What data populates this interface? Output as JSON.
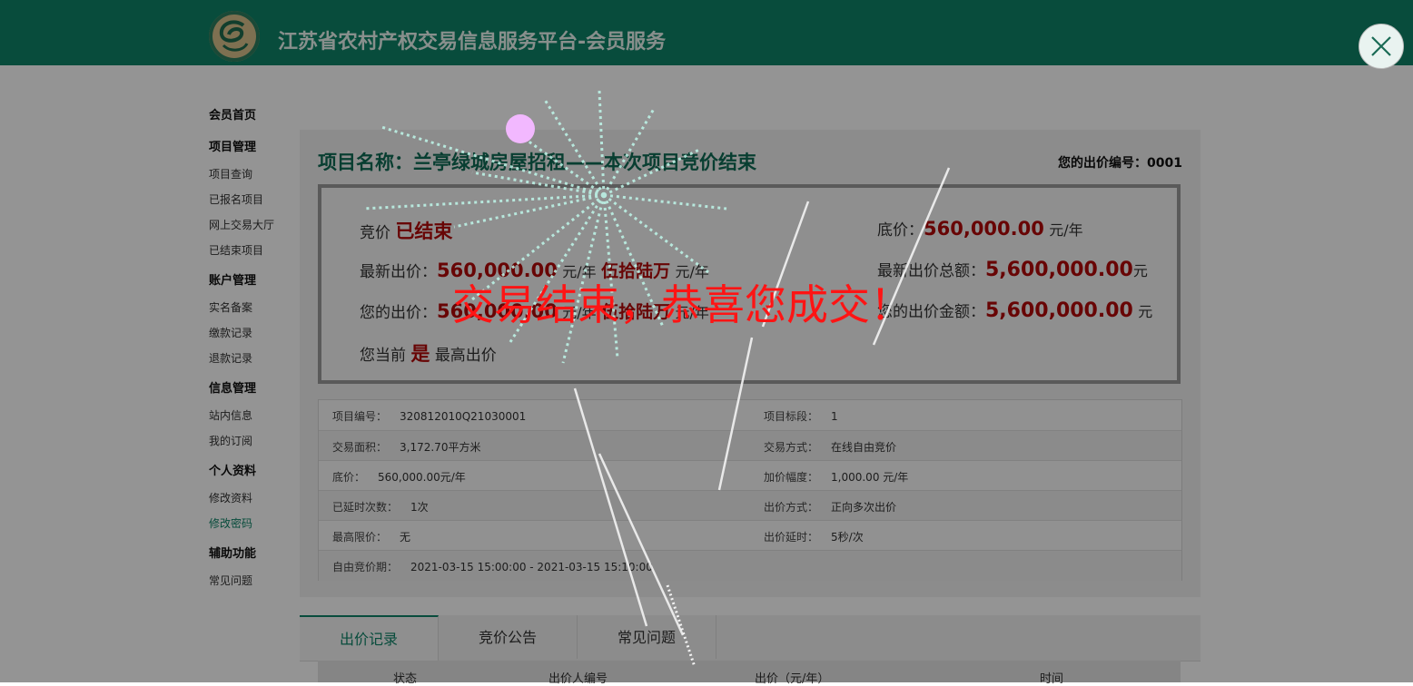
{
  "header": {
    "site_title": "江苏省农村产权交易信息服务平台-会员服务"
  },
  "sidebar": {
    "sections": [
      {
        "title": "会员首页",
        "items": []
      },
      {
        "title": "项目管理",
        "items": [
          "项目查询",
          "已报名项目",
          "网上交易大厅",
          "已结束项目"
        ]
      },
      {
        "title": "账户管理",
        "items": [
          "实名备案",
          "缴款记录",
          "退款记录"
        ]
      },
      {
        "title": "信息管理",
        "items": [
          "站内信息",
          "我的订阅"
        ]
      },
      {
        "title": "个人资料",
        "items": [
          "修改资料",
          "修改密码"
        ]
      },
      {
        "title": "辅助功能",
        "items": [
          "常见问题"
        ]
      }
    ]
  },
  "project": {
    "title": "项目名称：兰亭绿城房屋招租——本次项目竞价结束",
    "bid_number": "您的出价编号：0001",
    "summary": {
      "status_label": "竞价",
      "status_value": "已结束",
      "base_label": "底价：",
      "base_value": "560,000.00",
      "base_unit": "元/年",
      "latest_label": "最新出价：",
      "latest_value": "560,000.00",
      "latest_unit": "元/年",
      "latest_cn": "伍拾陆万",
      "latest_cn_unit": "元/年",
      "latest_total_label": "最新出价总额：",
      "latest_total_value": "5,600,000.00",
      "latest_total_unit": "元",
      "your_label": "您的出价：",
      "your_value": "560,000.00",
      "your_unit": "元/年",
      "your_cn": "伍拾陆万",
      "your_cn_unit": "元/年",
      "your_total_label": "您的出价金额：",
      "your_total_value": "5,600,000.00",
      "your_total_unit": "元",
      "current_prefix": "您当前",
      "current_value": "是",
      "current_suffix": "最高出价"
    },
    "details": [
      {
        "l1": "项目编号：",
        "v1": "320812010Q21030001",
        "l2": "项目标段：",
        "v2": "1"
      },
      {
        "l1": "交易面积：",
        "v1": "3,172.70平方米",
        "l2": "交易方式：",
        "v2": "在线自由竞价"
      },
      {
        "l1": "底价：",
        "v1": "560,000.00元/年",
        "l2": "加价幅度：",
        "v2": "1,000.00 元/年"
      },
      {
        "l1": "已延时次数：",
        "v1": "1次",
        "l2": "出价方式：",
        "v2": "正向多次出价"
      },
      {
        "l1": "最高限价：",
        "v1": "无",
        "l2": "出价延时：",
        "v2": "5秒/次"
      },
      {
        "l1": "自由竞价期：",
        "v1": "2021-03-15 15:00:00 - 2021-03-15 15:10:00",
        "l2": "",
        "v2": ""
      }
    ]
  },
  "tabs": [
    "出价记录",
    "竞价公告",
    "常见问题"
  ],
  "table_headers": [
    "状态",
    "出价人编号",
    "出价（元/年）",
    "时间"
  ],
  "overlay": {
    "message": "交易结束，恭喜您成交！"
  },
  "colors": {
    "brand": "#0f8468",
    "price": "#b30a0a",
    "message": "#ff1414"
  }
}
